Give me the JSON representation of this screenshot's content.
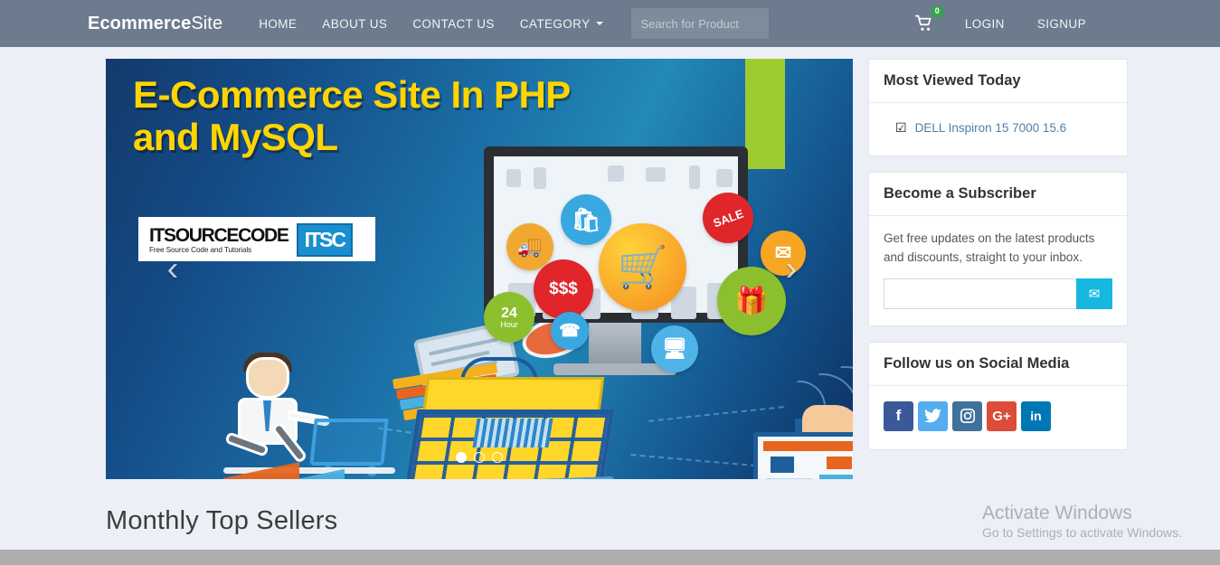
{
  "navbar": {
    "brand_bold": "Ecommerce",
    "brand_light": "Site",
    "links": [
      {
        "label": "HOME"
      },
      {
        "label": "ABOUT US"
      },
      {
        "label": "CONTACT US"
      },
      {
        "label": "CATEGORY"
      }
    ],
    "search": {
      "placeholder": "Search for Product",
      "value": ""
    },
    "cart": {
      "icon": "shopping-cart-icon",
      "badge_count": "0"
    },
    "login_label": "LOGIN",
    "signup_label": "SIGNUP",
    "background_color": "#6c7b8d"
  },
  "carousel": {
    "banner": {
      "title_line1": "E-Commerce Site In PHP",
      "title_line2": "and MySQL",
      "title_color": "#ffd500",
      "logo_main": "ITSOURCECODE",
      "logo_sub": "Free Source Code and Tutorials",
      "logo_mark": "ITSC",
      "bubble_sale": "SALE",
      "bubble_dollar": "$$$",
      "bubble_24": "24",
      "bubble_24_sub": "Hour"
    },
    "prev_icon": "chevron-left-icon",
    "next_icon": "chevron-right-icon",
    "indicators": [
      {
        "active": true
      },
      {
        "active": false
      },
      {
        "active": false
      }
    ]
  },
  "main": {
    "section_title": "Monthly Top Sellers"
  },
  "sidebar": {
    "most_viewed": {
      "title": "Most Viewed Today",
      "items": [
        {
          "icon": "checkbox-checked-icon",
          "label": "DELL Inspiron 15 7000 15.6"
        }
      ]
    },
    "subscriber": {
      "title": "Become a Subscriber",
      "description": "Get free updates on the latest products and discounts, straight to your inbox.",
      "input_value": "",
      "input_placeholder": "",
      "button_icon": "envelope-icon",
      "button_color": "#17b8e0"
    },
    "social": {
      "title": "Follow us on Social Media",
      "items": [
        {
          "name": "facebook",
          "glyph": "f",
          "color": "#3b5998"
        },
        {
          "name": "twitter",
          "glyph": "ᴗ",
          "color": "#55acee"
        },
        {
          "name": "instagram",
          "glyph": "▣",
          "color": "#3f729b"
        },
        {
          "name": "google-plus",
          "glyph": "G+",
          "color": "#dd4b39"
        },
        {
          "name": "linkedin",
          "glyph": "in",
          "color": "#0077b5"
        }
      ]
    }
  },
  "watermark": {
    "title": "Activate Windows",
    "subtitle": "Go to Settings to activate Windows."
  }
}
